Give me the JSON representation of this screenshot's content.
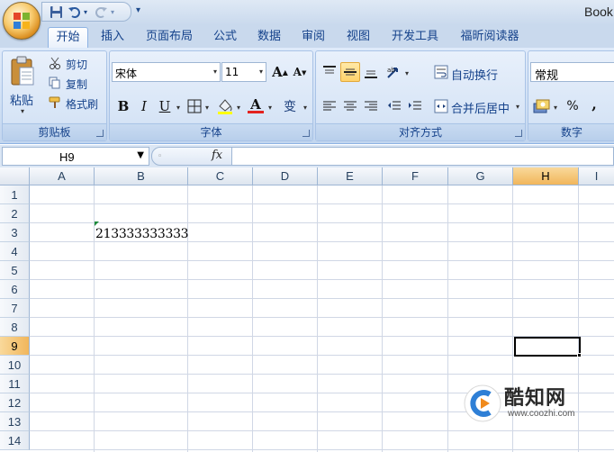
{
  "window": {
    "title": "Book"
  },
  "quick_access": {
    "icons": [
      "save-icon",
      "undo-icon",
      "redo-icon",
      "customize-icon"
    ]
  },
  "tabs": [
    {
      "label": "开始",
      "active": true
    },
    {
      "label": "插入"
    },
    {
      "label": "页面布局"
    },
    {
      "label": "公式"
    },
    {
      "label": "数据"
    },
    {
      "label": "审阅"
    },
    {
      "label": "视图"
    },
    {
      "label": "开发工具"
    },
    {
      "label": "福昕阅读器"
    }
  ],
  "ribbon": {
    "clipboard": {
      "group_label": "剪贴板",
      "paste_label": "粘贴",
      "cut_label": "剪切",
      "copy_label": "复制",
      "format_painter_label": "格式刷"
    },
    "font": {
      "group_label": "字体",
      "font_name": "宋体",
      "font_size": "11",
      "bold": "B",
      "italic": "I",
      "underline": "U",
      "grow_label": "A",
      "shrink_label": "A",
      "font_color_label": "A",
      "phonetic_label": "变",
      "accent_color": "#e3231f"
    },
    "alignment": {
      "group_label": "对齐方式",
      "wrap_text_label": "自动换行",
      "merge_center_label": "合并后居中"
    },
    "number": {
      "group_label": "数字",
      "format_value": "常规",
      "percent_label": "%",
      "comma_label": ","
    }
  },
  "formula_bar": {
    "name_box": "H9",
    "fx_label": "fx",
    "formula": ""
  },
  "sheet": {
    "columns": [
      "A",
      "B",
      "C",
      "D",
      "E",
      "F",
      "G",
      "H",
      "I"
    ],
    "rows": [
      "1",
      "2",
      "3",
      "4",
      "5",
      "6",
      "7",
      "8",
      "9",
      "10",
      "11",
      "12",
      "13",
      "14"
    ],
    "selected_cell": "H9",
    "cells": {
      "B3": "213333333333"
    }
  },
  "watermark": {
    "title": "酷知网",
    "url": "www.coozhi.com"
  }
}
